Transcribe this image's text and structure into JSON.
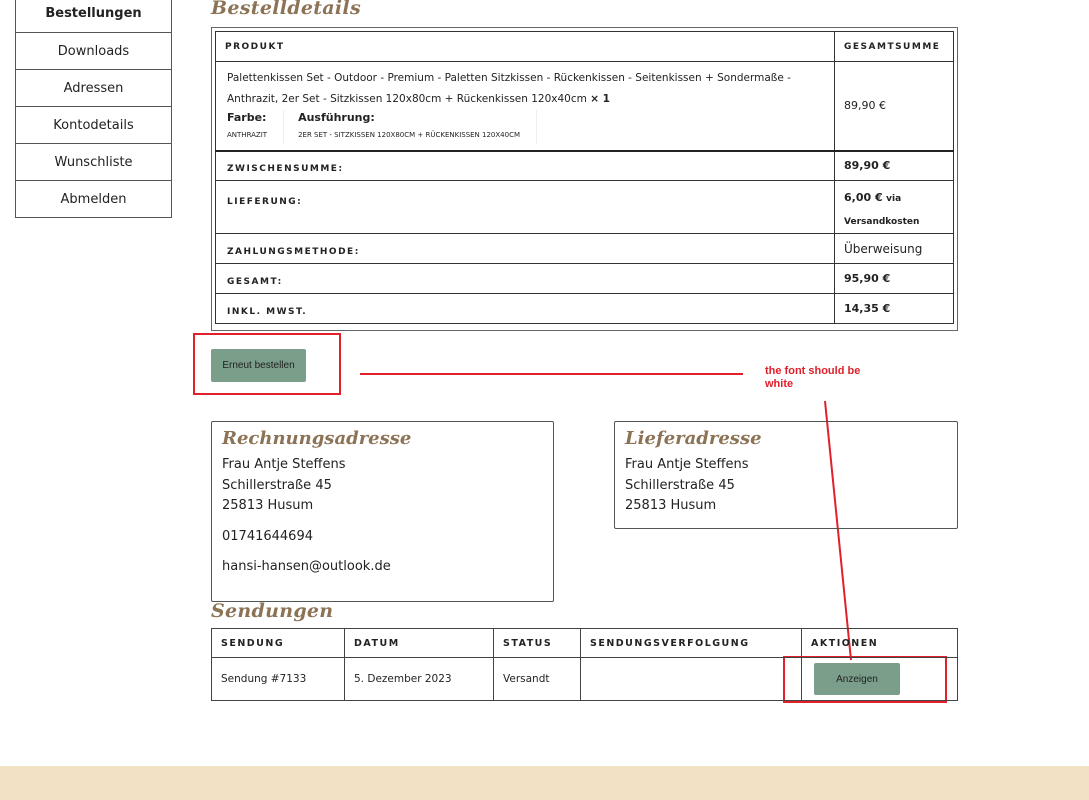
{
  "sidebar": {
    "items": [
      {
        "label": "Bestellungen",
        "active": true
      },
      {
        "label": "Downloads"
      },
      {
        "label": "Adressen"
      },
      {
        "label": "Kontodetails"
      },
      {
        "label": "Wunschliste"
      },
      {
        "label": "Abmelden"
      }
    ]
  },
  "order": {
    "title": "Bestelldetails",
    "col_product": "PRODUKT",
    "col_total": "GESAMTSUMME",
    "product": {
      "name": "Palettenkissen Set - Outdoor - Premium - Paletten Sitzkissen - Rückenkissen - Seitenkissen + Sondermaße - Anthrazit, 2er Set - Sitzkissen 120x80cm + Rückenkissen 120x40cm",
      "qty": "× 1",
      "meta": [
        {
          "key": "Farbe:",
          "value": "ANTHRAZIT"
        },
        {
          "key": "Ausführung:",
          "value": "2ER SET - SITZKISSEN 120X80CM + RÜCKENKISSEN 120X40CM"
        }
      ],
      "price": "89,90 €"
    },
    "rows": [
      {
        "label": "ZWISCHENSUMME:",
        "value": "89,90 €"
      },
      {
        "label": "LIEFERUNG:",
        "value": "6,00 €",
        "suffix": "via",
        "note": "Versandkosten"
      },
      {
        "label": "ZAHLUNGSMETHODE:",
        "value": "Überweisung"
      },
      {
        "label": "GESAMT:",
        "value": "95,90 €"
      },
      {
        "label": "INKL. MWST.",
        "value": "14,35 €"
      }
    ],
    "reorder_label": "Erneut bestellen"
  },
  "annotation": {
    "text": "the font should be white",
    "color": "#e0202a"
  },
  "billing": {
    "title": "Rechnungsadresse",
    "name": "Frau Antje Steffens",
    "street": "Schillerstraße 45",
    "city": "25813 Husum",
    "phone": "01741644694",
    "email": "hansi-hansen@outlook.de"
  },
  "shipping": {
    "title": "Lieferadresse",
    "name": "Frau Antje Steffens",
    "street": "Schillerstraße 45",
    "city": "25813 Husum"
  },
  "shipments": {
    "title": "Sendungen",
    "headers": [
      "SENDUNG",
      "DATUM",
      "STATUS",
      "SENDUNGSVERFOLGUNG",
      "AKTIONEN"
    ],
    "rows": [
      {
        "id": "Sendung #7133",
        "date": "5. Dezember 2023",
        "status": "Versandt",
        "tracking": "",
        "action": "Anzeigen"
      }
    ]
  },
  "colors": {
    "accent_title": "#8c7356",
    "button_bg": "#7a9e8a",
    "footer_bg": "#f2e1c5"
  }
}
